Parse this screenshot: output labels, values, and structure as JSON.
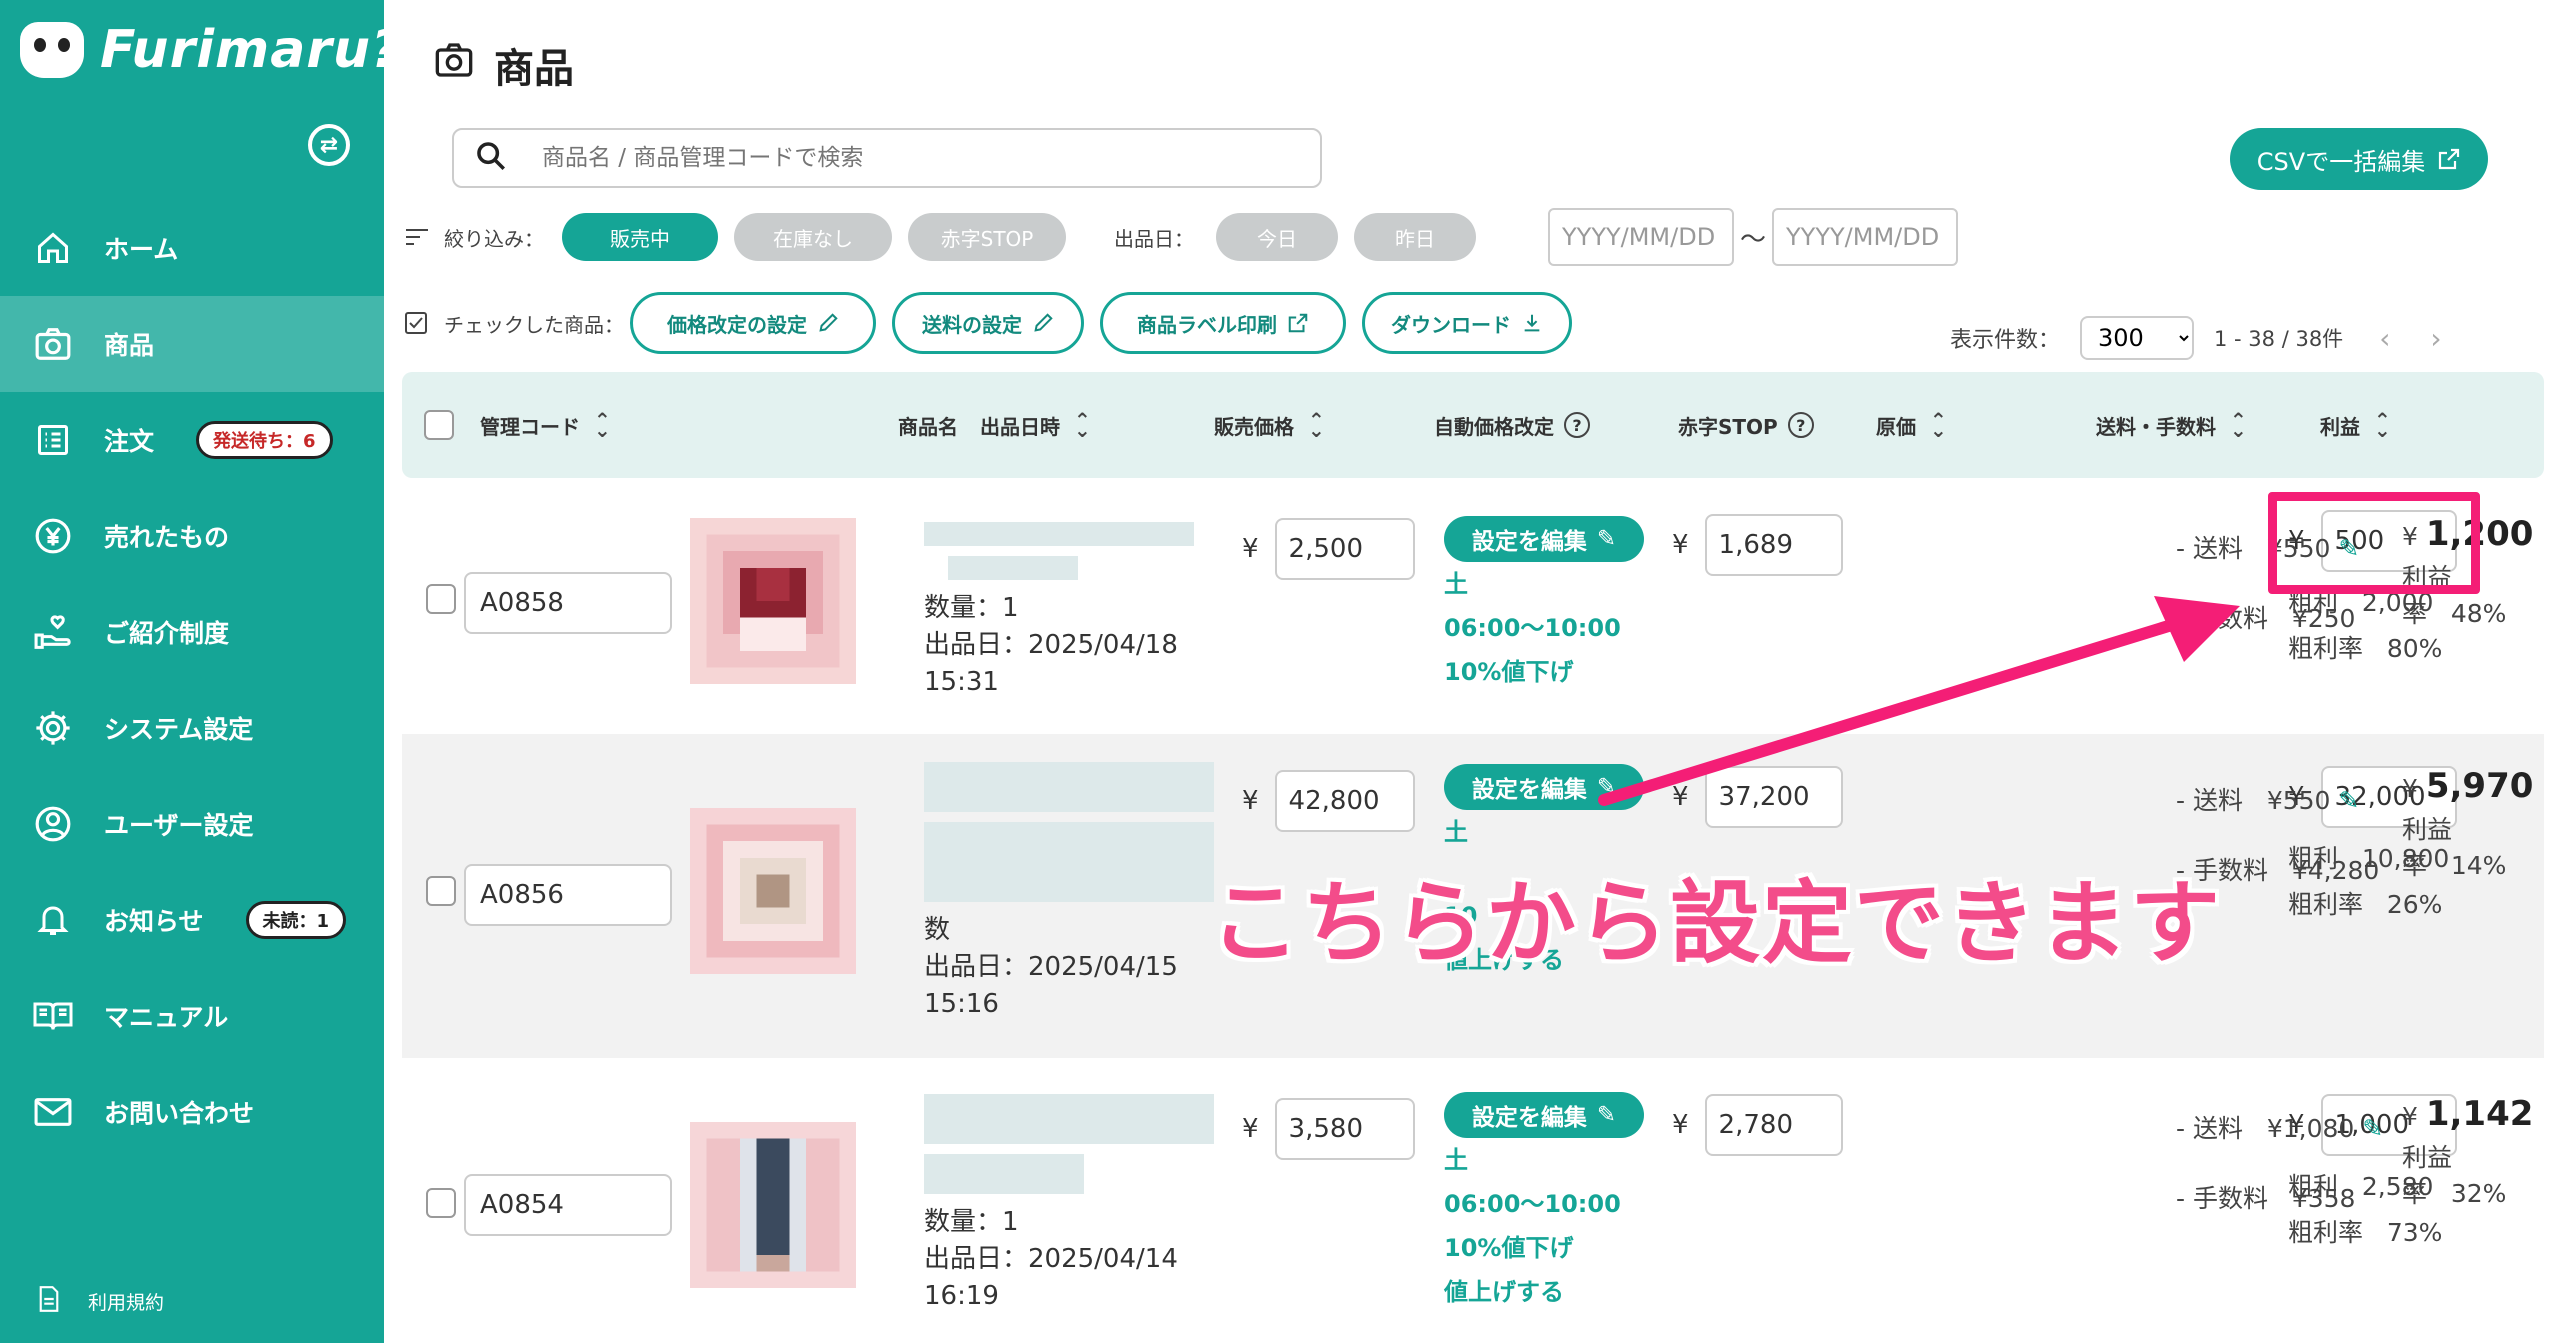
{
  "app": {
    "name": "Furimaru?"
  },
  "sidebar": {
    "items": [
      {
        "label": "ホーム",
        "icon": "home-icon"
      },
      {
        "label": "商品",
        "icon": "camera-icon",
        "active": true
      },
      {
        "label": "注文",
        "icon": "list-icon",
        "badge": "発送待ち：6"
      },
      {
        "label": "売れたもの",
        "icon": "yen-icon"
      },
      {
        "label": "ご紹介制度",
        "icon": "hand-heart-icon"
      },
      {
        "label": "システム設定",
        "icon": "gear-icon"
      },
      {
        "label": "ユーザー設定",
        "icon": "user-icon"
      },
      {
        "label": "お知らせ",
        "icon": "bell-icon",
        "badge": "未読：1"
      },
      {
        "label": "マニュアル",
        "icon": "book-icon"
      },
      {
        "label": "お問い合わせ",
        "icon": "mail-icon"
      }
    ],
    "terms": "利用規約"
  },
  "page": {
    "title": "商品"
  },
  "search": {
    "placeholder": "商品名 / 商品管理コードで検索"
  },
  "csv_button": "CSVで一括編集",
  "filters": {
    "label": "絞り込み：",
    "status": [
      "販売中",
      "在庫なし",
      "赤字STOP"
    ],
    "date_label": "出品日：",
    "dates": [
      "今日",
      "昨日"
    ],
    "date_from": "YYYY/MM/DD",
    "date_sep": "〜",
    "date_to": "YYYY/MM/DD"
  },
  "actions": {
    "label": "チェックした商品：",
    "buttons": [
      "価格改定の設定",
      "送料の設定",
      "商品ラベル印刷",
      "ダウンロード"
    ]
  },
  "pagination": {
    "label": "表示件数：",
    "per_page": "300",
    "range": "1 - 38 / 38件"
  },
  "columns": {
    "code": "管理コード",
    "name": "商品名",
    "listed": "出品日時",
    "price": "販売価格",
    "auto": "自動価格改定",
    "stop": "赤字STOP",
    "cost": "原価",
    "fees": "送料・手数料",
    "profit": "利益"
  },
  "rows": [
    {
      "code": "A0858",
      "qty": "数量：1",
      "listed": "出品日：2025/04/18",
      "time": "15:31",
      "yen": "¥",
      "price": "2,500",
      "edit": "設定を編集",
      "auto": [
        "土",
        "06:00〜10:00",
        "10%値下げ"
      ],
      "stop": "1,689",
      "cost": "500",
      "gross_label": "粗利",
      "gross": "2,000",
      "gross_rate_label": "粗利率",
      "gross_rate": "80%",
      "ship_label": "- 送料",
      "ship": "¥550",
      "fee_label": "- 手数料",
      "fee": "¥250",
      "profit": "1,200",
      "profit_rate_label": "利益率",
      "profit_rate": "48%"
    },
    {
      "code": "A0856",
      "qty": "数",
      "listed": "出品日：2025/04/15",
      "time": "15:16",
      "yen": "¥",
      "price": "42,800",
      "edit": "設定を編集",
      "auto": [
        "土",
        "10",
        "値上げする"
      ],
      "stop": "37,200",
      "cost": "32,000",
      "gross_label": "粗利",
      "gross": "10,800",
      "gross_rate_label": "粗利率",
      "gross_rate": "26%",
      "ship_label": "- 送料",
      "ship": "¥550",
      "fee_label": "- 手数料",
      "fee": "¥4,280",
      "profit": "5,970",
      "profit_rate_label": "利益率",
      "profit_rate": "14%"
    },
    {
      "code": "A0854",
      "qty": "数量：1",
      "listed": "出品日：2025/04/14",
      "time": "16:19",
      "yen": "¥",
      "price": "3,580",
      "edit": "設定を編集",
      "auto": [
        "土",
        "06:00〜10:00",
        "10%値下げ",
        "値上げする"
      ],
      "stop": "2,780",
      "cost": "1,000",
      "gross_label": "粗利",
      "gross": "2,580",
      "gross_rate_label": "粗利率",
      "gross_rate": "73%",
      "ship_label": "- 送料",
      "ship": "¥1,080",
      "fee_label": "- 手数料",
      "fee": "¥358",
      "profit": "1,142",
      "profit_rate_label": "利益率",
      "profit_rate": "32%"
    }
  ],
  "annotation": {
    "text": "こちらから設定できます",
    "color": "#f41e76"
  },
  "colors": {
    "brand": "#15a596",
    "header_bg": "#e3f2f0",
    "alt_row": "#f2f2f2"
  }
}
